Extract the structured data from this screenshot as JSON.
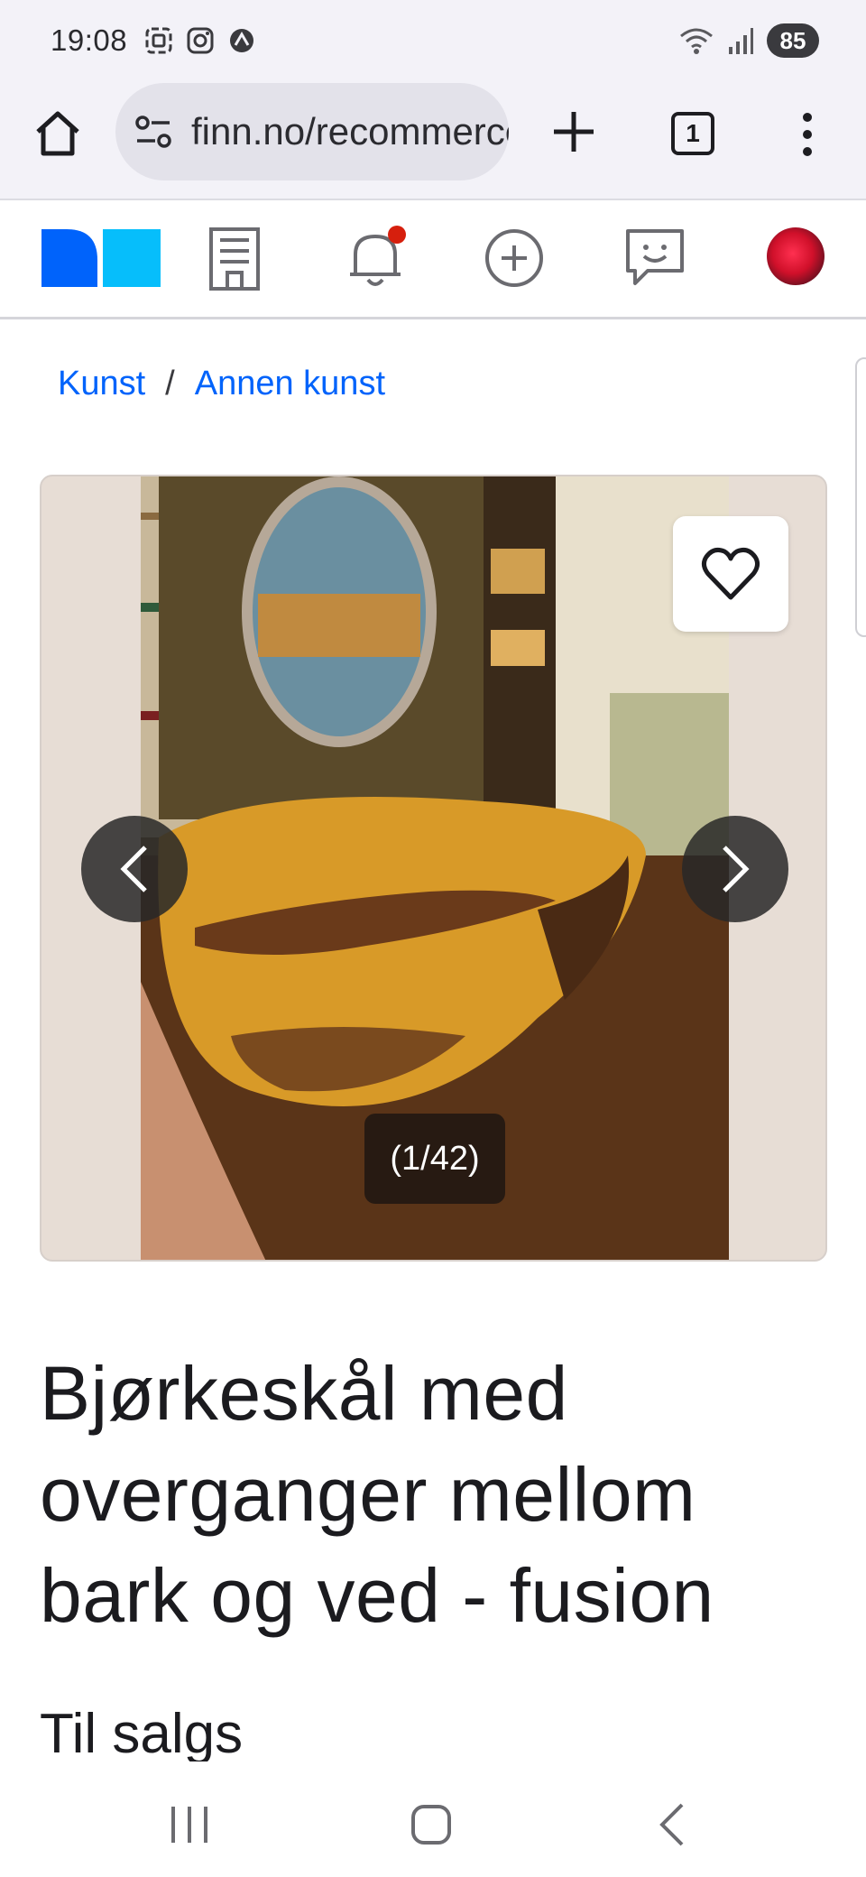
{
  "status_bar": {
    "time": "19:08",
    "battery": "85",
    "left_icons": [
      "screenshot-icon",
      "instagram-icon",
      "vpn-icon"
    ],
    "right_icons": [
      "wifi-icon",
      "signal-icon"
    ]
  },
  "browser": {
    "url": "finn.no/recommerce/forsale/item",
    "tab_count": "1"
  },
  "site_header": {
    "icons": [
      "finn-logo",
      "building-icon",
      "bell-icon",
      "add-circle-icon",
      "chat-icon",
      "avatar"
    ],
    "notification_dot_color": "#d61f0d"
  },
  "breadcrumb": {
    "items": [
      "Kunst",
      "Annen kunst"
    ],
    "separator": "/"
  },
  "gallery": {
    "counter": "(1/42)"
  },
  "listing": {
    "title": "Bjørkeskål med overganger mellom bark og ved - fusion",
    "section": "Til salgs"
  },
  "colors": {
    "link": "#0063fb",
    "logo_dark_blue": "#0063fb",
    "logo_light_blue": "#06befb"
  }
}
